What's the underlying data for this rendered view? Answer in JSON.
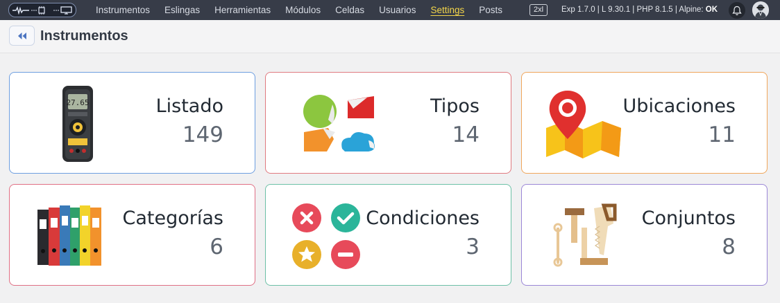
{
  "navbar": {
    "links": [
      {
        "label": "Instrumentos"
      },
      {
        "label": "Eslingas"
      },
      {
        "label": "Herramientas"
      },
      {
        "label": "Módulos"
      },
      {
        "label": "Celdas"
      },
      {
        "label": "Usuarios"
      },
      {
        "label": "Settings",
        "active": true
      },
      {
        "label": "Posts"
      }
    ],
    "size_badge": "2xl",
    "version_prefix": "Exp 1.7.0 | L 9.30.1 | PHP 8.1.5 | Alpine: ",
    "alpine_status": "OK",
    "icons": [
      "signal-icon",
      "chip-icon",
      "monitor-icon",
      "bell-icon",
      "user-avatar-icon"
    ]
  },
  "header": {
    "title": "Instrumentos",
    "back_icon": "double-chevron-left-icon"
  },
  "colors": {
    "navbar_bg": "#373c48",
    "active_link": "#f3d54a",
    "card_borders": [
      "#6d9ee0",
      "#e0797f",
      "#f0a55a",
      "#e06f84",
      "#6cc0a6",
      "#9a86d6"
    ]
  },
  "cards": [
    {
      "label": "Listado",
      "count": "149",
      "icon": "multimeter-icon"
    },
    {
      "label": "Tipos",
      "count": "14",
      "icon": "tags-icon"
    },
    {
      "label": "Ubicaciones",
      "count": "11",
      "icon": "map-pin-icon"
    },
    {
      "label": "Categorías",
      "count": "6",
      "icon": "binders-icon"
    },
    {
      "label": "Condiciones",
      "count": "3",
      "icon": "status-icons"
    },
    {
      "label": "Conjuntos",
      "count": "8",
      "icon": "tools-icon"
    }
  ]
}
